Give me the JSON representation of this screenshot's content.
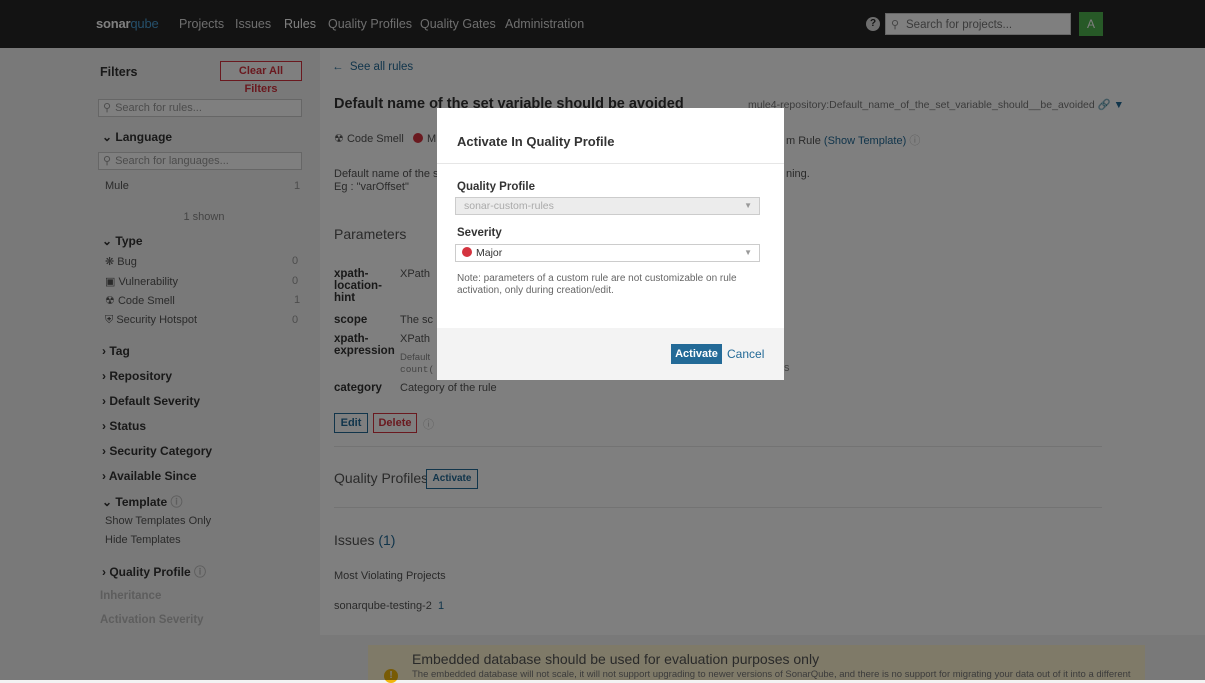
{
  "topbar": {
    "logo_main": "sonar",
    "logo_accent": "qube",
    "nav": [
      "Projects",
      "Issues",
      "Rules",
      "Quality Profiles",
      "Quality Gates",
      "Administration"
    ],
    "active_nav": "Rules",
    "search_placeholder": "Search for projects...",
    "avatar_letter": "A"
  },
  "sidebar": {
    "title": "Filters",
    "clear_label": "Clear All Filters",
    "search_rules_placeholder": "Search for rules...",
    "language": {
      "label": "Language",
      "search_placeholder": "Search for languages...",
      "item": "Mule",
      "count": "1",
      "shown": "1 shown"
    },
    "type": {
      "label": "Type",
      "items": [
        {
          "label": "Bug",
          "count": "0"
        },
        {
          "label": "Vulnerability",
          "count": "0"
        },
        {
          "label": "Code Smell",
          "count": "1"
        },
        {
          "label": "Security Hotspot",
          "count": "0"
        }
      ]
    },
    "facets": [
      "Tag",
      "Repository",
      "Default Severity",
      "Status",
      "Security Category",
      "Available Since"
    ],
    "template": {
      "label": "Template",
      "items": [
        "Show Templates Only",
        "Hide Templates"
      ]
    },
    "quality_profile": "Quality Profile",
    "muted": [
      "Inheritance",
      "Activation Severity"
    ]
  },
  "main": {
    "back_link": "See all rules",
    "rule_title": "Default name of the set variable should be avoided",
    "rule_key": "mule4-repository:Default_name_of_the_set_variable_should__be_avoided",
    "meta": {
      "type": "Code Smell",
      "severity_initial": "M",
      "custom_rule": "m Rule",
      "show_template": "(Show Template)"
    },
    "desc_line1": "Default name of the s",
    "desc_line1_end": "ning.",
    "desc_line2": "Eg : \"varOffset\"",
    "parameters_title": "Parameters",
    "params": [
      {
        "name": "xpath-location-hint",
        "desc": "XPath"
      },
      {
        "name": "scope",
        "desc": "The sc"
      },
      {
        "name": "xpath-expression",
        "desc": "XPath",
        "sub1": "Default",
        "sub2": "count(",
        "tail": "s"
      },
      {
        "name": "category",
        "desc": "Category of the rule"
      }
    ],
    "edit_label": "Edit",
    "delete_label": "Delete",
    "quality_profiles_title": "Quality Profiles",
    "qp_activate_label": "Activate",
    "issues_title": "Issues",
    "issues_count": "(1)",
    "most_violating": "Most Violating Projects",
    "project": "sonarqube-testing-2",
    "project_count": "1",
    "banner_title": "Embedded database should be used for evaluation purposes only",
    "banner_text": "The embedded database will not scale, it will not support upgrading to newer versions of SonarQube, and there is no support for migrating your data out of it into a different"
  },
  "modal": {
    "title": "Activate In Quality Profile",
    "profile_label": "Quality Profile",
    "profile_value": "sonar-custom-rules",
    "severity_label": "Severity",
    "severity_value": "Major",
    "note": "Note: parameters of a custom rule are not customizable on rule activation, only during creation/edit.",
    "activate_label": "Activate",
    "cancel_label": "Cancel"
  },
  "colors": {
    "topbar": "#262626",
    "link": "#236a97",
    "danger": "#d4333f",
    "avatar": "#4fb34f"
  }
}
